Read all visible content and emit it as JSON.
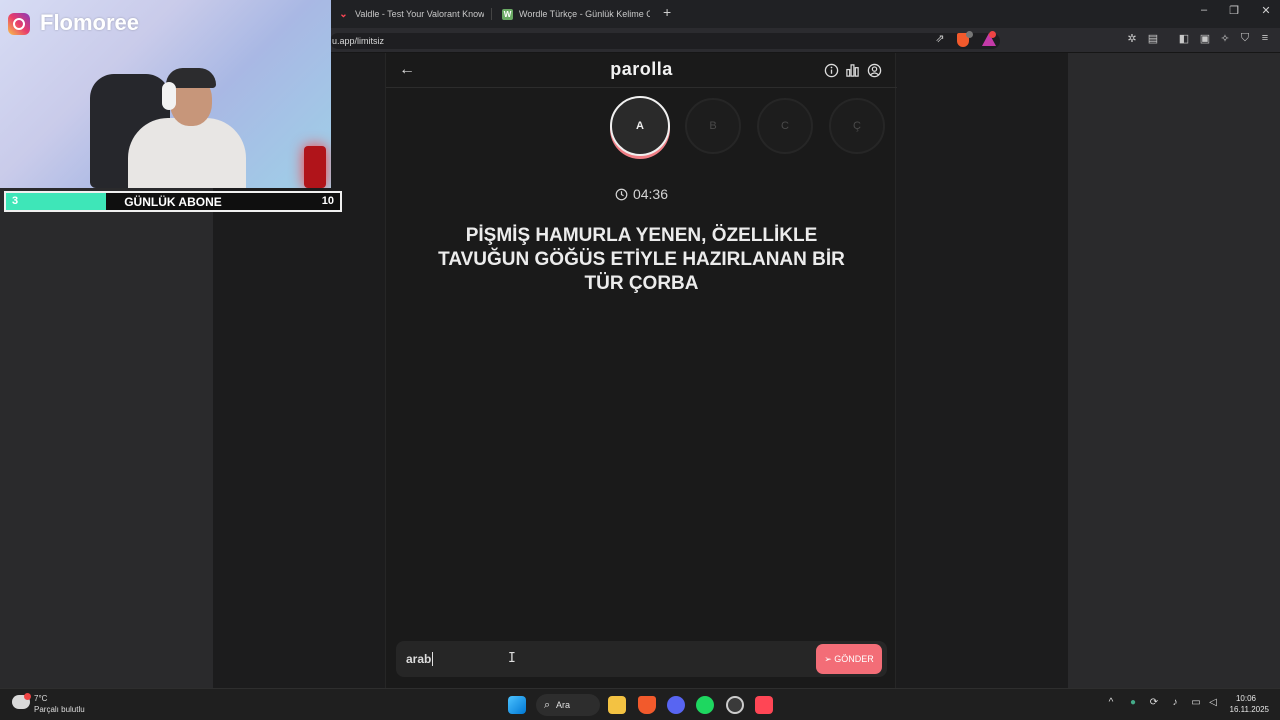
{
  "browser": {
    "tabs": [
      {
        "title": "Valdle - Test Your Valorant Knowledg",
        "icon": "valdle-favicon"
      },
      {
        "title": "Wordle Türkçe - Günlük Kelime Oyun",
        "icon": "wordle-favicon"
      }
    ],
    "new_tab_label": "+",
    "url": "u.app/limitsiz"
  },
  "app": {
    "title": "parolla",
    "letters": [
      {
        "label": "A",
        "state": "active"
      },
      {
        "label": "B",
        "state": "inactive"
      },
      {
        "label": "C",
        "state": "inactive"
      },
      {
        "label": "Ç",
        "state": "inactive"
      }
    ],
    "timer": "04:36",
    "question": "PİŞMİŞ HAMURLA YENEN, ÖZELLİKLE TAVUĞUN GÖĞÜS ETİYLE HAZIRLANAN BİR TÜR ÇORBA",
    "answer": {
      "value": "arab",
      "send_label": "GÖNDER"
    },
    "colors": {
      "accent": "#f36d77",
      "background": "#1a1a1a"
    }
  },
  "stream_overlay": {
    "channel_name": "Flomoree",
    "subgoal": {
      "current": "3",
      "label": "GÜNLÜK ABONE",
      "goal": "10",
      "progress": 0.3,
      "fill_color": "#3ee6b8"
    }
  },
  "taskbar": {
    "weather": {
      "temp": "7°C",
      "desc": "Parçalı bulutlu"
    },
    "search_label": "Ara",
    "time": "10:06",
    "date": "16.11.2025"
  }
}
